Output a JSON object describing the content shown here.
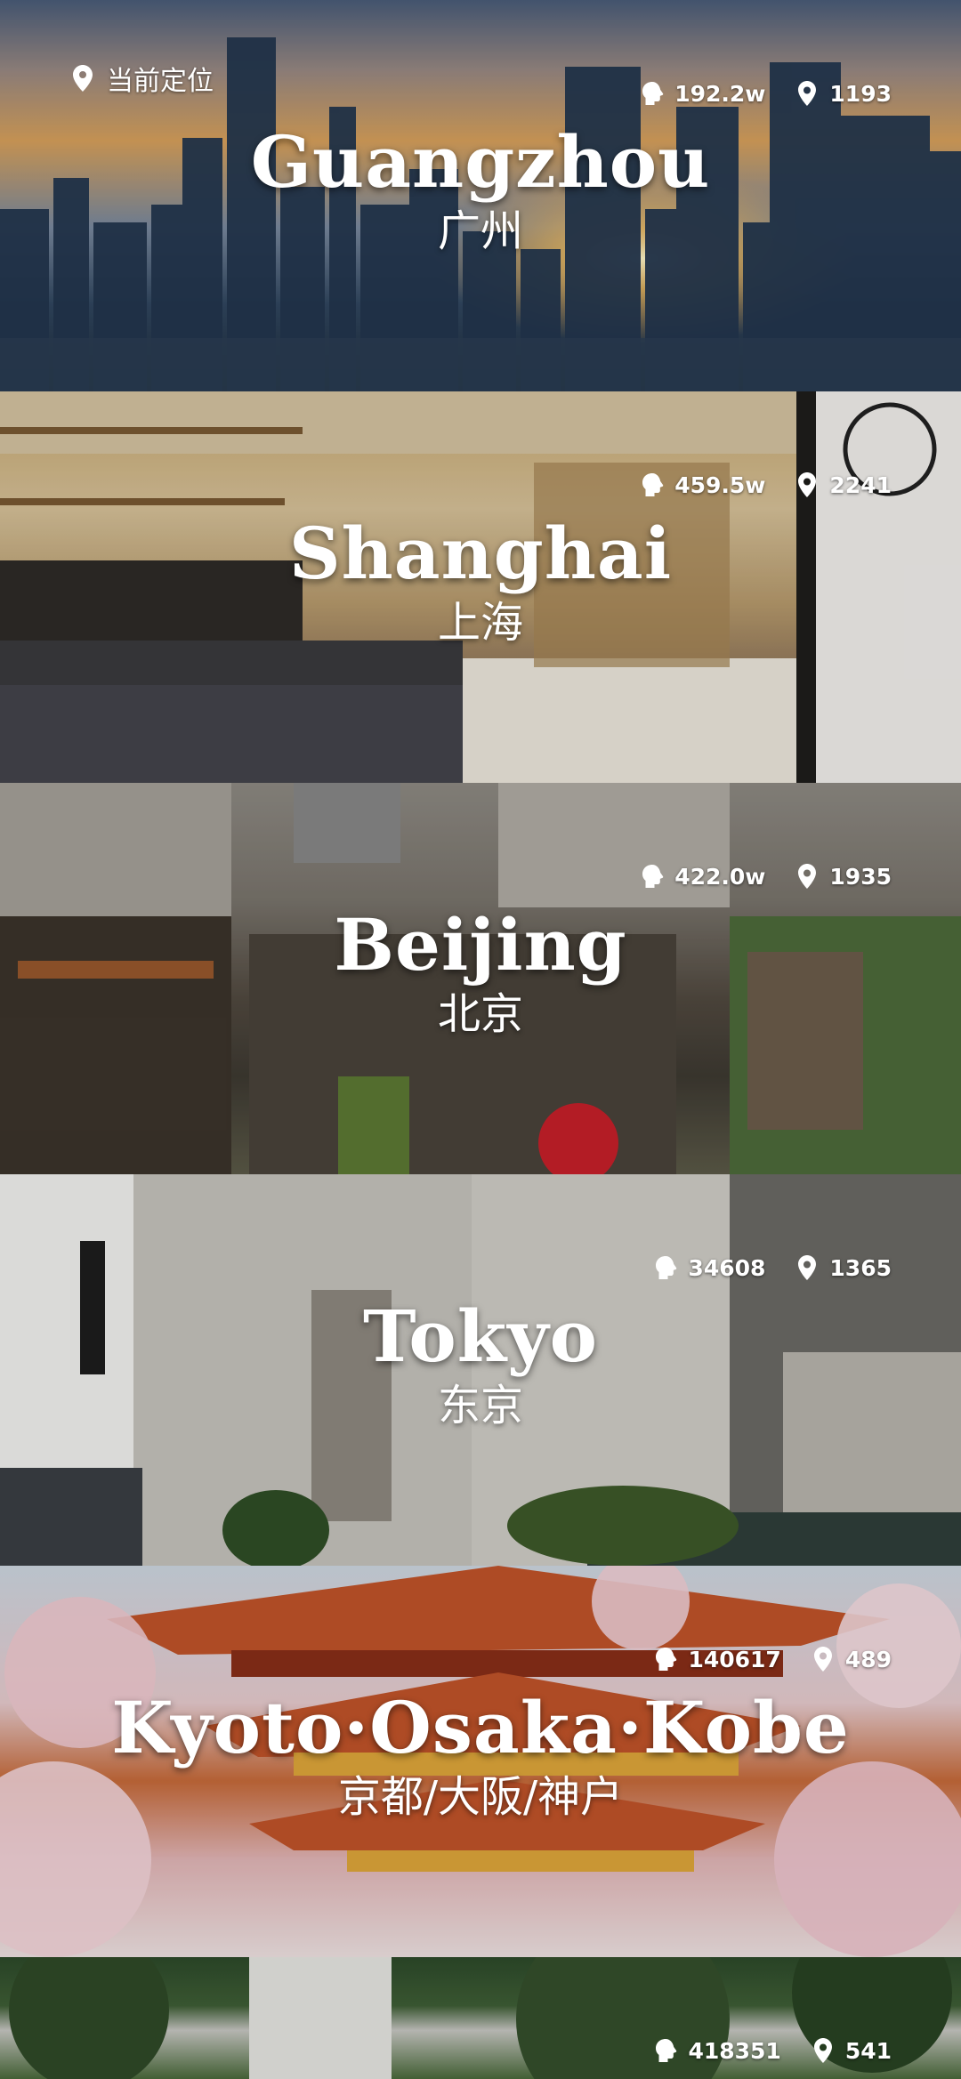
{
  "location_button": {
    "label": "当前定位",
    "icon": "location-pin-icon"
  },
  "cities": [
    {
      "en": "Guangzhou",
      "zh": "广州",
      "views": "192.2w",
      "places": "1193"
    },
    {
      "en": "Shanghai",
      "zh": "上海",
      "views": "459.5w",
      "places": "2241"
    },
    {
      "en": "Beijing",
      "zh": "北京",
      "views": "422.0w",
      "places": "1935"
    },
    {
      "en": "Tokyo",
      "zh": "东京",
      "views": "34608",
      "places": "1365"
    },
    {
      "en": "Kyoto·Osaka·Kobe",
      "zh": "京都/大阪/神户",
      "views": "140617",
      "places": "489"
    },
    {
      "en": "",
      "zh": "",
      "views": "418351",
      "places": "541"
    }
  ],
  "icons": {
    "views": "head-icon",
    "places": "location-pin-icon"
  },
  "colors": {
    "text": "#ffffff",
    "overlay": "#000000"
  }
}
